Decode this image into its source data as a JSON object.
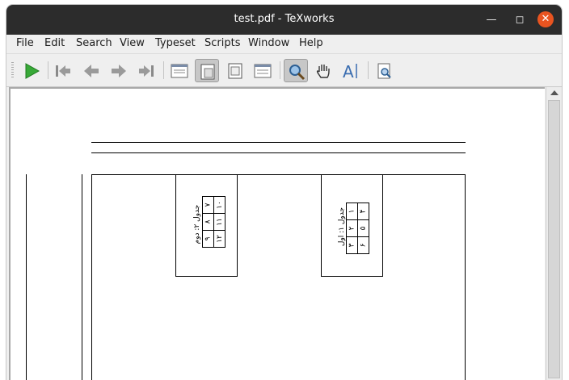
{
  "window": {
    "title": "test.pdf - TeXworks"
  },
  "menu": {
    "items": [
      "File",
      "Edit",
      "Search",
      "View",
      "Typeset",
      "Scripts",
      "Window",
      "Help"
    ]
  },
  "toolbar": {
    "buttons": [
      {
        "icon": "play-typeset-icon"
      },
      {
        "icon": "first-page-icon"
      },
      {
        "icon": "previous-page-icon"
      },
      {
        "icon": "next-page-icon"
      },
      {
        "icon": "last-page-icon"
      },
      {
        "icon": "actual-size-icon"
      },
      {
        "icon": "fit-width-icon"
      },
      {
        "icon": "fit-window-icon"
      },
      {
        "icon": "continuous-scroll-icon"
      },
      {
        "icon": "magnify-icon"
      },
      {
        "icon": "pan-hand-icon"
      },
      {
        "icon": "select-text-icon"
      },
      {
        "icon": "find-icon"
      }
    ],
    "accent": "#2a9d2a"
  },
  "document": {
    "table_right": {
      "caption": "جدول ۱: اول",
      "rows": [
        [
          "۱",
          "۲",
          "۳"
        ],
        [
          "۴",
          "۵",
          "۶"
        ]
      ]
    },
    "table_left": {
      "caption": "جدول ۲: دوم",
      "rows": [
        [
          "۷",
          "۸",
          "۹"
        ],
        [
          "۱۰",
          "۱۱",
          "۱۲"
        ]
      ]
    }
  }
}
